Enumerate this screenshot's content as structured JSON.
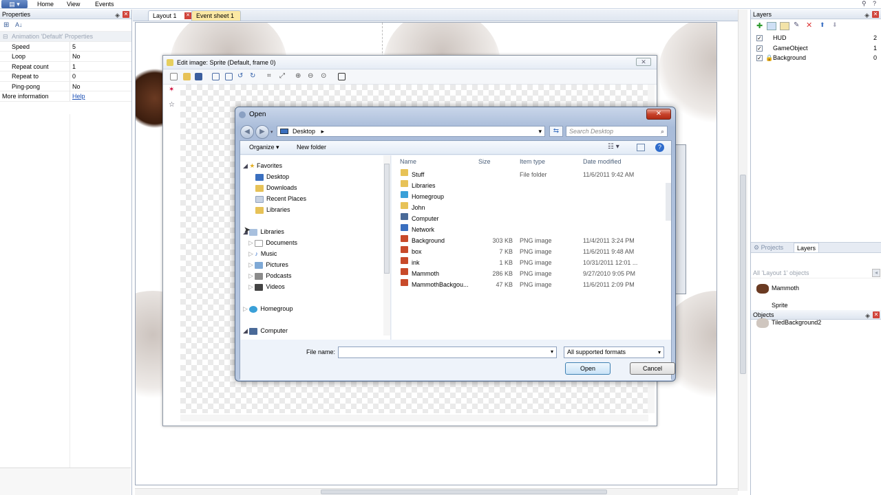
{
  "menubar": {
    "items": [
      "Home",
      "View",
      "Events"
    ]
  },
  "properties": {
    "title": "Properties",
    "section": "Animation 'Default' Properties",
    "rows": [
      {
        "key": "Speed",
        "value": "5"
      },
      {
        "key": "Loop",
        "value": "No"
      },
      {
        "key": "Repeat count",
        "value": "1"
      },
      {
        "key": "Repeat to",
        "value": "0"
      },
      {
        "key": "Ping-pong",
        "value": "No"
      }
    ],
    "more_label": "More information",
    "more_link": "Help"
  },
  "tabs": [
    {
      "label": "Layout 1"
    },
    {
      "label": "Event sheet 1"
    }
  ],
  "layers": {
    "title": "Layers",
    "items": [
      {
        "name": "HUD",
        "index": "2"
      },
      {
        "name": "GameObject",
        "index": "1"
      },
      {
        "name": "Background",
        "index": "0"
      }
    ],
    "tabs": [
      "Projects",
      "Layers"
    ]
  },
  "objects": {
    "title": "Objects",
    "filter": "All 'Layout 1' objects",
    "items": [
      "Mammoth",
      "Sprite",
      "TiledBackground2"
    ]
  },
  "edit_image": {
    "title": "Edit image: Sprite (Default, frame 0)"
  },
  "open_dialog": {
    "title": "Open",
    "location": "Desktop",
    "search_placeholder": "Search Desktop",
    "organize": "Organize",
    "new_folder": "New folder",
    "nav": {
      "favorites": "Favorites",
      "favorite_items": [
        "Desktop",
        "Downloads",
        "Recent Places",
        "Libraries"
      ],
      "libraries": "Libraries",
      "library_items": [
        "Documents",
        "Music",
        "Pictures",
        "Podcasts",
        "Videos"
      ],
      "homegroup": "Homegroup",
      "computer": "Computer"
    },
    "columns": {
      "name": "Name",
      "size": "Size",
      "type": "Item type",
      "date": "Date modified"
    },
    "files": [
      {
        "name": "Stuff",
        "size": "",
        "type": "File folder",
        "date": "11/6/2011 9:42 AM",
        "icon": "folder"
      },
      {
        "name": "Libraries",
        "size": "",
        "type": "",
        "date": "",
        "icon": "library"
      },
      {
        "name": "Homegroup",
        "size": "",
        "type": "",
        "date": "",
        "icon": "homegroup"
      },
      {
        "name": "John",
        "size": "",
        "type": "",
        "date": "",
        "icon": "user-folder"
      },
      {
        "name": "Computer",
        "size": "",
        "type": "",
        "date": "",
        "icon": "computer"
      },
      {
        "name": "Network",
        "size": "",
        "type": "",
        "date": "",
        "icon": "network"
      },
      {
        "name": "Background",
        "size": "303 KB",
        "type": "PNG image",
        "date": "11/4/2011 3:24 PM",
        "icon": "png"
      },
      {
        "name": "box",
        "size": "7 KB",
        "type": "PNG image",
        "date": "11/6/2011 9:48 AM",
        "icon": "png"
      },
      {
        "name": "ink",
        "size": "1 KB",
        "type": "PNG image",
        "date": "10/31/2011 12:01 ...",
        "icon": "png"
      },
      {
        "name": "Mammoth",
        "size": "286 KB",
        "type": "PNG image",
        "date": "9/27/2010 9:05 PM",
        "icon": "png"
      },
      {
        "name": "MammothBackgou...",
        "size": "47 KB",
        "type": "PNG image",
        "date": "11/6/2011 2:09 PM",
        "icon": "png"
      }
    ],
    "filename_label": "File name:",
    "filename_value": "",
    "filter": "All supported formats",
    "open_label": "Open",
    "cancel_label": "Cancel"
  }
}
